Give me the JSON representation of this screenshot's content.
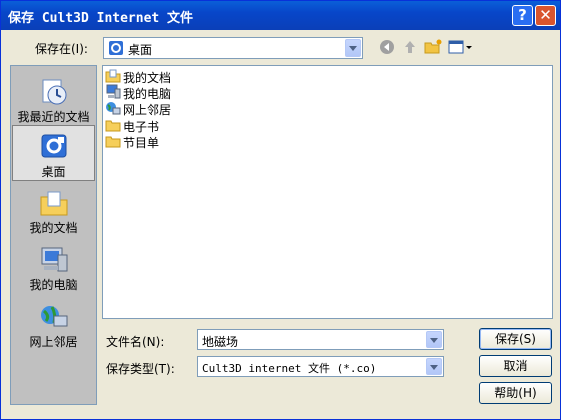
{
  "window": {
    "title": "保存 Cult3D Internet 文件",
    "help_glyph": "?",
    "close_glyph": "✕"
  },
  "toolbar": {
    "save_in_label": "保存在(I):",
    "save_in_value": "桌面",
    "back_icon": "back-icon",
    "up_icon": "up-folder-icon",
    "new_folder_icon": "new-folder-icon",
    "view_icon": "view-menu-icon"
  },
  "places": [
    {
      "label": "我最近的文档",
      "icon": "recent-documents-icon"
    },
    {
      "label": "桌面",
      "icon": "desktop-icon",
      "selected": true
    },
    {
      "label": "我的文档",
      "icon": "my-documents-icon"
    },
    {
      "label": "我的电脑",
      "icon": "my-computer-icon"
    },
    {
      "label": "网上邻居",
      "icon": "network-places-icon"
    }
  ],
  "files": [
    {
      "name": "我的文档",
      "icon": "my-documents-icon"
    },
    {
      "name": "我的电脑",
      "icon": "my-computer-icon"
    },
    {
      "name": "网上邻居",
      "icon": "network-places-icon"
    },
    {
      "name": "电子书",
      "icon": "folder-icon"
    },
    {
      "name": "节目单",
      "icon": "folder-icon"
    }
  ],
  "form": {
    "filename_label": "文件名(N):",
    "filename_value": "地磁场",
    "filetype_label": "保存类型(T):",
    "filetype_value": "Cult3D internet 文件 (*.co)"
  },
  "buttons": {
    "save": "保存(S)",
    "cancel": "取消",
    "help": "帮助(H)"
  }
}
